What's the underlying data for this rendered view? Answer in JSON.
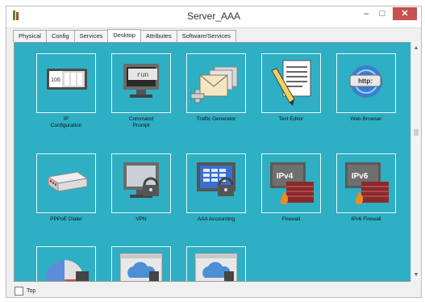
{
  "window": {
    "title": "Server_AAA",
    "minimize_glyph": "–",
    "maximize_glyph": "□",
    "close_glyph": "✕",
    "icon": "cisco-app-icon"
  },
  "tabs": [
    {
      "label": "Physical",
      "active": false
    },
    {
      "label": "Config",
      "active": false
    },
    {
      "label": "Services",
      "active": false
    },
    {
      "label": "Desktop",
      "active": true
    },
    {
      "label": "Attributes",
      "active": false
    },
    {
      "label": "Software/Services",
      "active": false
    }
  ],
  "desktop": {
    "background_color": "#2eafc4",
    "apps": [
      {
        "label": "IP\nConfiguration",
        "icon": "ip-configuration-icon",
        "ip_text": "106"
      },
      {
        "label": "Command\nPrompt",
        "icon": "command-prompt-icon",
        "screen_text": "run"
      },
      {
        "label": "Traffic Generator",
        "icon": "traffic-generator-icon"
      },
      {
        "label": "Text Editor",
        "icon": "text-editor-icon"
      },
      {
        "label": "Web Browser",
        "icon": "web-browser-icon",
        "badge": "http:"
      },
      {
        "label": "PPPoE Dialer",
        "icon": "pppoe-dialer-icon"
      },
      {
        "label": "VPN",
        "icon": "vpn-icon"
      },
      {
        "label": "AAA Accounting",
        "icon": "aaa-accounting-icon"
      },
      {
        "label": "Firewall",
        "icon": "firewall-icon",
        "badge": "IPv4"
      },
      {
        "label": "IPv6 Firewall",
        "icon": "ipv6-firewall-icon",
        "badge": "IPv6"
      },
      {
        "label": "",
        "icon": "netflow-collector-icon"
      },
      {
        "label": "",
        "icon": "iot-monitor-icon"
      },
      {
        "label": "",
        "icon": "cloud-device-icon"
      }
    ]
  },
  "footer": {
    "top_checkbox_label": "Top",
    "top_checked": false
  },
  "scrollbar": {
    "up_glyph": "▲",
    "down_glyph": "▼"
  }
}
